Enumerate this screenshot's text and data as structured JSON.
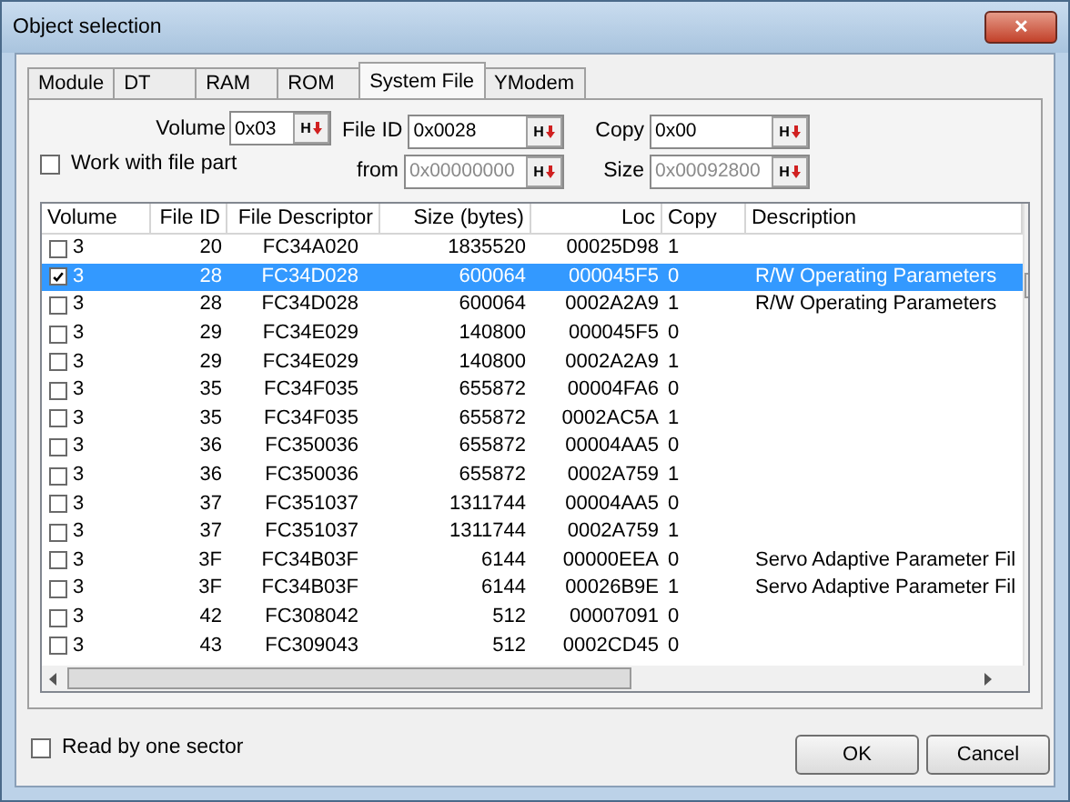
{
  "window": {
    "title": "Object selection",
    "close": "✕"
  },
  "tabs": [
    {
      "label": "Module",
      "selected": false
    },
    {
      "label": "DT",
      "selected": false
    },
    {
      "label": "RAM",
      "selected": false
    },
    {
      "label": "ROM",
      "selected": false
    },
    {
      "label": "System File",
      "selected": true
    },
    {
      "label": "YModem",
      "selected": false
    }
  ],
  "fields": [
    {
      "label": "Volume",
      "value": "0x03",
      "hex_button": "H",
      "disabled": false
    },
    {
      "label": "File ID",
      "value": "0x0028",
      "hex_button": "H",
      "disabled": false
    },
    {
      "label": "Copy",
      "value": "0x00",
      "hex_button": "H",
      "disabled": false
    },
    {
      "label": "from",
      "value": "0x00000000",
      "hex_button": "H",
      "disabled": true
    },
    {
      "label": "Size",
      "value": "0x00092800",
      "hex_button": "H",
      "disabled": true
    }
  ],
  "work_with_file_part": {
    "label": "Work with file part",
    "checked": false
  },
  "table": {
    "columns": [
      "Volume",
      "File ID",
      "File Descriptor",
      "Size (bytes)",
      "Loc",
      "Copy",
      "Description"
    ],
    "rows": [
      {
        "checked": false,
        "selected": false,
        "cells": [
          "3",
          "20",
          "FC34A020",
          "1835520",
          "00025D98",
          "1",
          ""
        ]
      },
      {
        "checked": true,
        "selected": true,
        "cells": [
          "3",
          "28",
          "FC34D028",
          "600064",
          "000045F5",
          "0",
          "R/W Operating Parameters"
        ]
      },
      {
        "checked": false,
        "selected": false,
        "cells": [
          "3",
          "28",
          "FC34D028",
          "600064",
          "0002A2A9",
          "1",
          "R/W Operating Parameters"
        ]
      },
      {
        "checked": false,
        "selected": false,
        "cells": [
          "3",
          "29",
          "FC34E029",
          "140800",
          "000045F5",
          "0",
          ""
        ]
      },
      {
        "checked": false,
        "selected": false,
        "cells": [
          "3",
          "29",
          "FC34E029",
          "140800",
          "0002A2A9",
          "1",
          ""
        ]
      },
      {
        "checked": false,
        "selected": false,
        "cells": [
          "3",
          "35",
          "FC34F035",
          "655872",
          "00004FA6",
          "0",
          ""
        ]
      },
      {
        "checked": false,
        "selected": false,
        "cells": [
          "3",
          "35",
          "FC34F035",
          "655872",
          "0002AC5A",
          "1",
          ""
        ]
      },
      {
        "checked": false,
        "selected": false,
        "cells": [
          "3",
          "36",
          "FC350036",
          "655872",
          "00004AA5",
          "0",
          ""
        ]
      },
      {
        "checked": false,
        "selected": false,
        "cells": [
          "3",
          "36",
          "FC350036",
          "655872",
          "0002A759",
          "1",
          ""
        ]
      },
      {
        "checked": false,
        "selected": false,
        "cells": [
          "3",
          "37",
          "FC351037",
          "1311744",
          "00004AA5",
          "0",
          ""
        ]
      },
      {
        "checked": false,
        "selected": false,
        "cells": [
          "3",
          "37",
          "FC351037",
          "1311744",
          "0002A759",
          "1",
          ""
        ]
      },
      {
        "checked": false,
        "selected": false,
        "cells": [
          "3",
          "3F",
          "FC34B03F",
          "6144",
          "00000EEA",
          "0",
          "Servo Adaptive Parameter Fil"
        ]
      },
      {
        "checked": false,
        "selected": false,
        "cells": [
          "3",
          "3F",
          "FC34B03F",
          "6144",
          "00026B9E",
          "1",
          "Servo Adaptive Parameter Fil"
        ]
      },
      {
        "checked": false,
        "selected": false,
        "cells": [
          "3",
          "42",
          "FC308042",
          "512",
          "00007091",
          "0",
          ""
        ]
      },
      {
        "checked": false,
        "selected": false,
        "cells": [
          "3",
          "43",
          "FC309043",
          "512",
          "0002CD45",
          "0",
          ""
        ]
      }
    ]
  },
  "read_by_one_sector": {
    "label": "Read by one sector",
    "checked": false
  },
  "buttons": [
    "OK",
    "Cancel"
  ]
}
